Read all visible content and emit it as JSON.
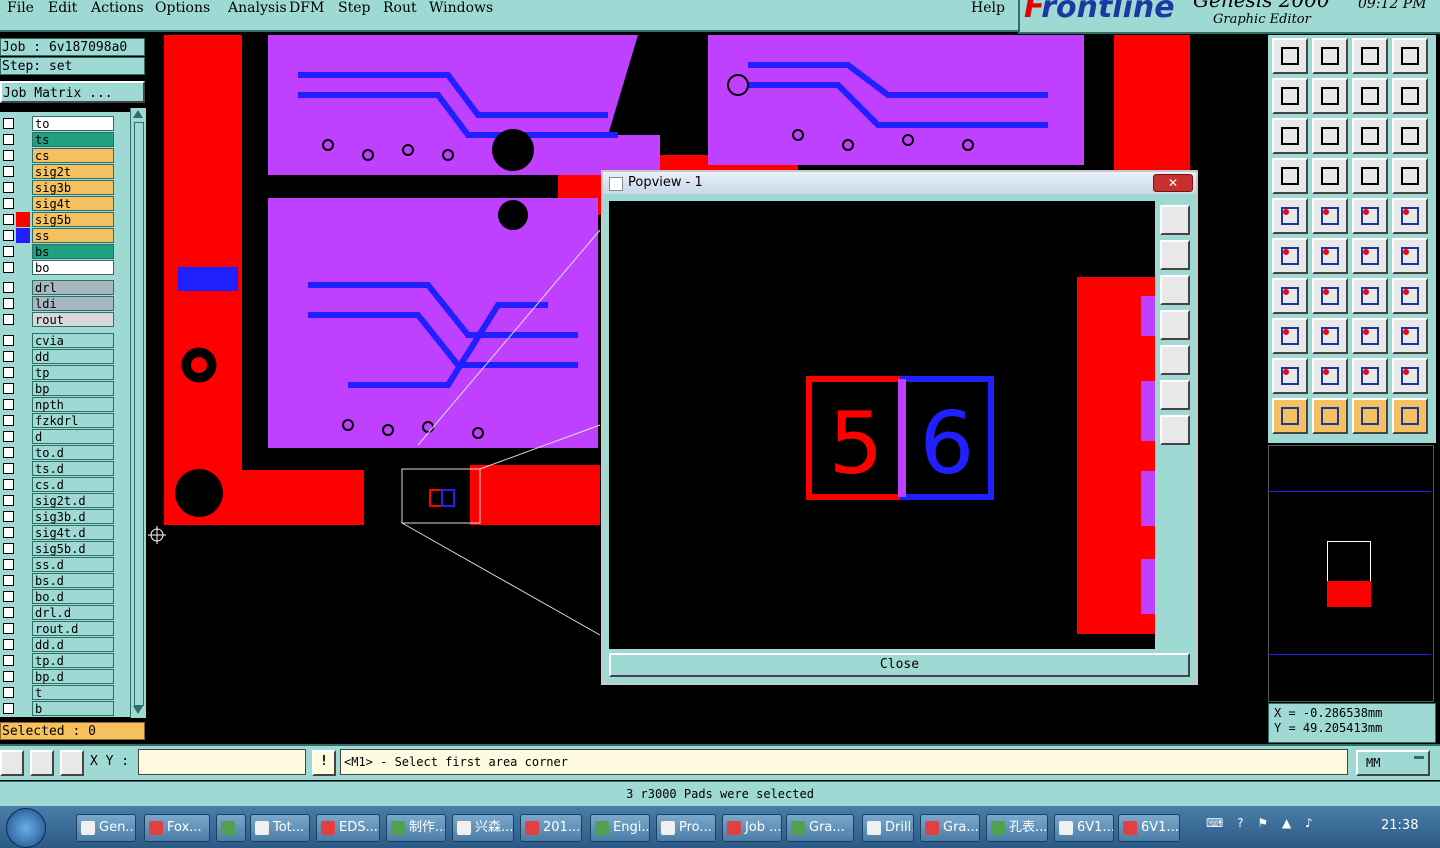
{
  "menu": {
    "items": [
      "File",
      "Edit",
      "Actions",
      "Options",
      "Analysis",
      "DFM",
      "Step",
      "Rout",
      "Windows"
    ],
    "help": "Help"
  },
  "brand": {
    "logo": "Frontline",
    "product": "Genesis 2000",
    "subtitle": "Graphic Editor",
    "time": "09:12 PM"
  },
  "job": {
    "job_label": "Job : 6v187098a0",
    "step_label": "Step: set",
    "matrix_button": "Job Matrix ..."
  },
  "layers": {
    "board": [
      {
        "name": "to",
        "color": "#ffffff"
      },
      {
        "name": "ts",
        "color": "#20a080"
      },
      {
        "name": "cs",
        "color": "#f5c060"
      },
      {
        "name": "sig2t",
        "color": "#f5c060"
      },
      {
        "name": "sig3b",
        "color": "#f5c060"
      },
      {
        "name": "sig4t",
        "color": "#f5c060"
      },
      {
        "name": "sig5b",
        "color": "#f5c060"
      },
      {
        "name": "ss",
        "color": "#f5c060"
      },
      {
        "name": "bs",
        "color": "#20a080"
      },
      {
        "name": "bo",
        "color": "#ffffff"
      }
    ],
    "drill": [
      {
        "name": "drl",
        "color": "#a8b8c0"
      },
      {
        "name": "ldi",
        "color": "#a8b8c0"
      },
      {
        "name": "rout",
        "color": "#d8d8d8"
      }
    ],
    "misc": [
      "cvia",
      "dd",
      "tp",
      "bp",
      "npth",
      "fzkdrl",
      "d",
      "to.d",
      "ts.d",
      "cs.d",
      "sig2t.d",
      "sig3b.d",
      "sig4t.d",
      "sig5b.d",
      "ss.d",
      "bs.d",
      "bo.d",
      "drl.d",
      "rout.d",
      "dd.d",
      "tp.d",
      "bp.d",
      "t",
      "b"
    ]
  },
  "selected_label": "Selected : 0",
  "popview": {
    "title": "Popview - 1",
    "close_label": "Close",
    "digit_left": "5",
    "digit_right": "6"
  },
  "coords": {
    "x": "X = -0.286538mm",
    "y": "Y = 49.205413mm"
  },
  "command": {
    "xy_label": "X Y :",
    "input_value": "",
    "prompt": "<M1> - Select first area corner",
    "units": "MM"
  },
  "status": "3 r3000 Pads were selected",
  "taskbar": {
    "items": [
      "Gen...",
      "Fox...",
      "",
      "Tot...",
      "EDS...",
      "制作...",
      "兴森...",
      "201...",
      "Engi...",
      "Pro...",
      "Job ...",
      "Gra...",
      "Drill...",
      "Gra...",
      "孔表...",
      "6V1...",
      "6V1..."
    ],
    "clock": "21:38"
  },
  "colors": {
    "panel": "#9fd9d3",
    "red": "#ff0000",
    "blue": "#2020ff",
    "magenta": "#c040ff",
    "highlight": "#f5c060"
  }
}
